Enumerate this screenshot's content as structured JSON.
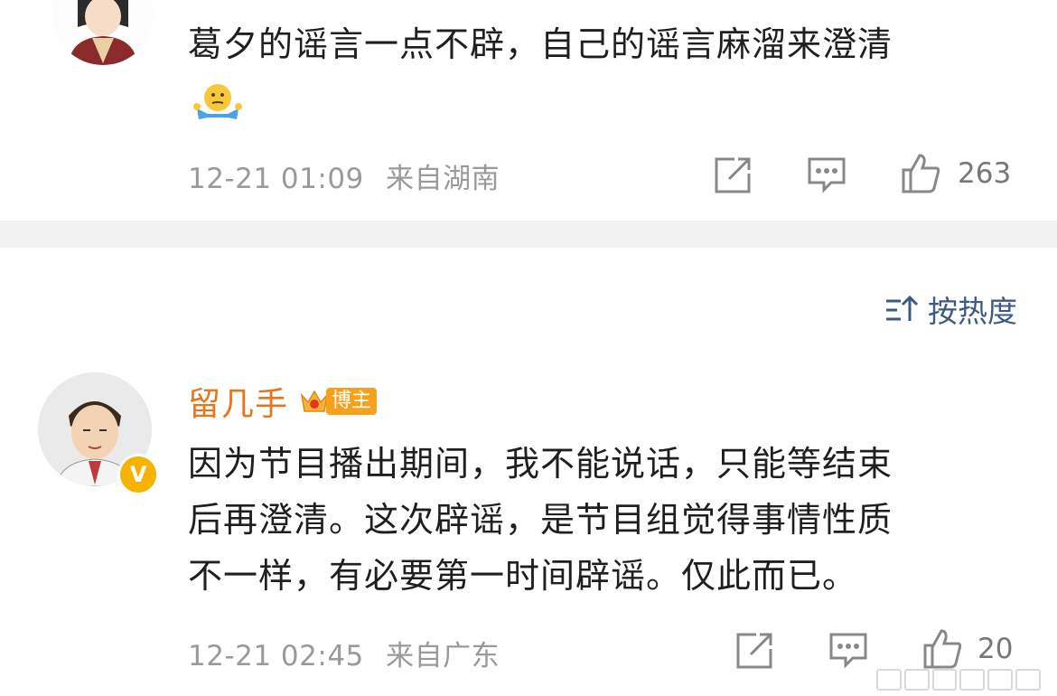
{
  "comments": [
    {
      "text": "葛夕的谣言一点不辟，自己的谣言麻溜来澄清",
      "emoji": "🤷",
      "time": "12-21 01:09",
      "location": "来自湖南",
      "likes": "263"
    },
    {
      "username": "留几手",
      "badge": "博主",
      "verified_icon": "v-badge-icon",
      "text_lines": [
        "因为节目播出期间，我不能说话，只能等结束",
        "后再澄清。这次辟谣，是节目组觉得事情性质",
        "不一样，有必要第一时间辟谣。仅此而已。"
      ],
      "time": "12-21 02:45",
      "location": "来自广东",
      "likes": "20"
    }
  ],
  "sort": {
    "label": "按热度",
    "icon": "sort-icon"
  },
  "icons": {
    "share": "share-icon",
    "comment": "comment-icon",
    "like": "thumbs-up-icon"
  },
  "colors": {
    "username": "#e8741c",
    "link": "#3d5a84",
    "meta": "#9a9a9a",
    "divider": "#f2f2f2",
    "badge": "#f7a11a"
  }
}
